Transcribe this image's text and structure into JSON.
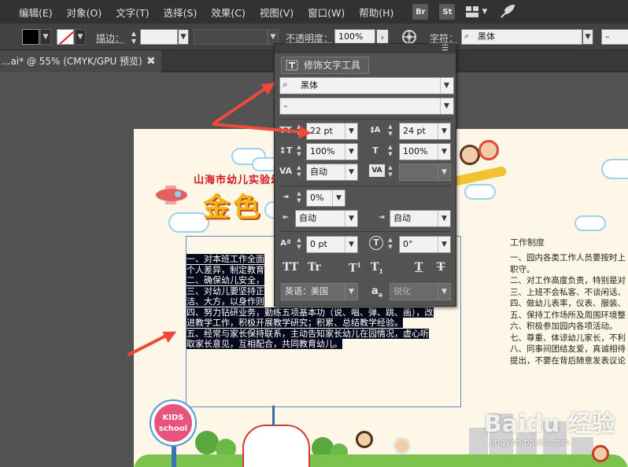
{
  "menu": [
    "编辑(E)",
    "对象(O)",
    "文字(T)",
    "选择(S)",
    "效果(C)",
    "视图(V)",
    "窗口(W)",
    "帮助(H)"
  ],
  "app_buttons": {
    "bridge": "Br",
    "stock": "St"
  },
  "control": {
    "stroke_label": "描边：",
    "opacity_label": "不透明度：",
    "opacity_value": "100%",
    "char_label": "字符：",
    "font_value": "黑体",
    "style_value": "–"
  },
  "tab": {
    "title": "...ai* @ 55% (CMYK/GPU 预览)",
    "close": "✖"
  },
  "panel": {
    "touch_button": "修饰文字工具",
    "font_family": "黑体",
    "font_style": "–",
    "font_size": "22 pt",
    "leading": "24 pt",
    "vertical_scale": "100%",
    "horizontal_scale": "100%",
    "kerning": "自动",
    "tracking": "",
    "tsume": "0%",
    "aki_left": "自动",
    "aki_right": "自动",
    "baseline_shift": "0 pt",
    "rotation": "0°",
    "language": "英语：美国",
    "antialias_label": "a",
    "antialias_sub": "a",
    "antialias": "锐化",
    "caps": [
      "TT",
      "Tr",
      "T",
      "T",
      "T",
      "T"
    ],
    "caps_marks": [
      "1",
      "1"
    ]
  },
  "artboard": {
    "title_red": "山海市幼儿实验幼",
    "title_gold": "金色",
    "selected_lines": [
      "一、对本班工作全面",
      "个人差异，制定教育",
      "二、确保幼儿安全，",
      "三、对幼儿要坚持正",
      "洁、大方，以身作则",
      "四、努力钻研业务，勤练五项基本功（说、唱、弹、跳、画），改",
      "进教学工作，积极开展教学研究；积累、总结教学经验。",
      "五、经常与家长保持联系，主动告知家长幼儿在园情况，虚心听",
      "取家长意见，互相配合，共同教育幼儿。"
    ],
    "rules_title": "工作制度",
    "rules": [
      "一、园内各类工作人员要按时上",
      "职守。",
      "二、对工作高度负责，特别是对",
      "三、上班不会私客、不谈闲话、",
      "四、做幼儿表率，仪表、服装、",
      "五、保持工作场所及周围环境整",
      "六、积极参加园内各项活动。",
      "七、尊重、体谅幼儿家长，不利",
      "八、同事间团结友爱，真诚相待",
      "提出，不要在背后随意发表议论"
    ],
    "kids_badge": [
      "KIDS",
      "school"
    ],
    "watermark": "Baidu 经验",
    "watermark_sub": "jingyan.baidu.com"
  }
}
